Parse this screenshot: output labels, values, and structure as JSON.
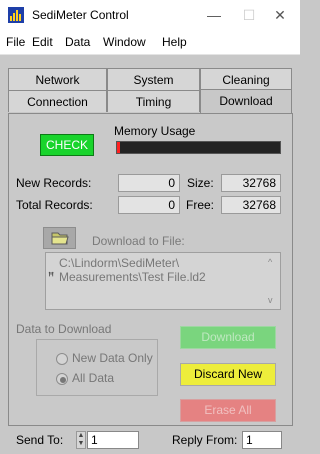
{
  "window": {
    "title": "SediMeter Control",
    "minimize": "—",
    "maximize": "☐",
    "close": "✕"
  },
  "menu": [
    "File",
    "Edit",
    "Data",
    "Window",
    "Help"
  ],
  "tabs": {
    "row1": [
      "Network",
      "System",
      "Cleaning"
    ],
    "row2": [
      "Connection",
      "Timing",
      "Download"
    ],
    "active": "Download"
  },
  "download": {
    "check_label": "CHECK",
    "memory_label": "Memory Usage",
    "memory_usage_fraction": 0.02,
    "new_records_label": "New Records:",
    "new_records_value": "0",
    "total_records_label": "Total Records:",
    "total_records_value": "0",
    "size_label": "Size:",
    "size_value": "32768",
    "free_label": "Free:",
    "free_value": "32768",
    "download_to_label": "Download to File:",
    "path": "C:\\Lindorm\\SediMeter\\\nMeasurements\\Test File.ld2",
    "cursor_mark": "ꟸ",
    "scroll_up": "^",
    "scroll_down": "v",
    "data_to_download_label": "Data to Download",
    "options": [
      "New Data Only",
      "All Data"
    ],
    "selected_option": "All Data",
    "download_btn": "Download",
    "discard_btn": "Discard New",
    "erase_btn": "Erase All"
  },
  "bottom": {
    "send_to_label": "Send To:",
    "send_to_value": "1",
    "spinner_up": "▲",
    "spinner_down": "▼",
    "reply_from_label": "Reply From:",
    "reply_from_value": "1"
  },
  "colors": {
    "check_green": "#19d42c",
    "discard_yellow": "#eded3b",
    "erase_red": "#e58282",
    "download_green": "#7ad57e",
    "memory_fill": "#ff2020",
    "app_icon_blue": "#1e3fa8"
  }
}
